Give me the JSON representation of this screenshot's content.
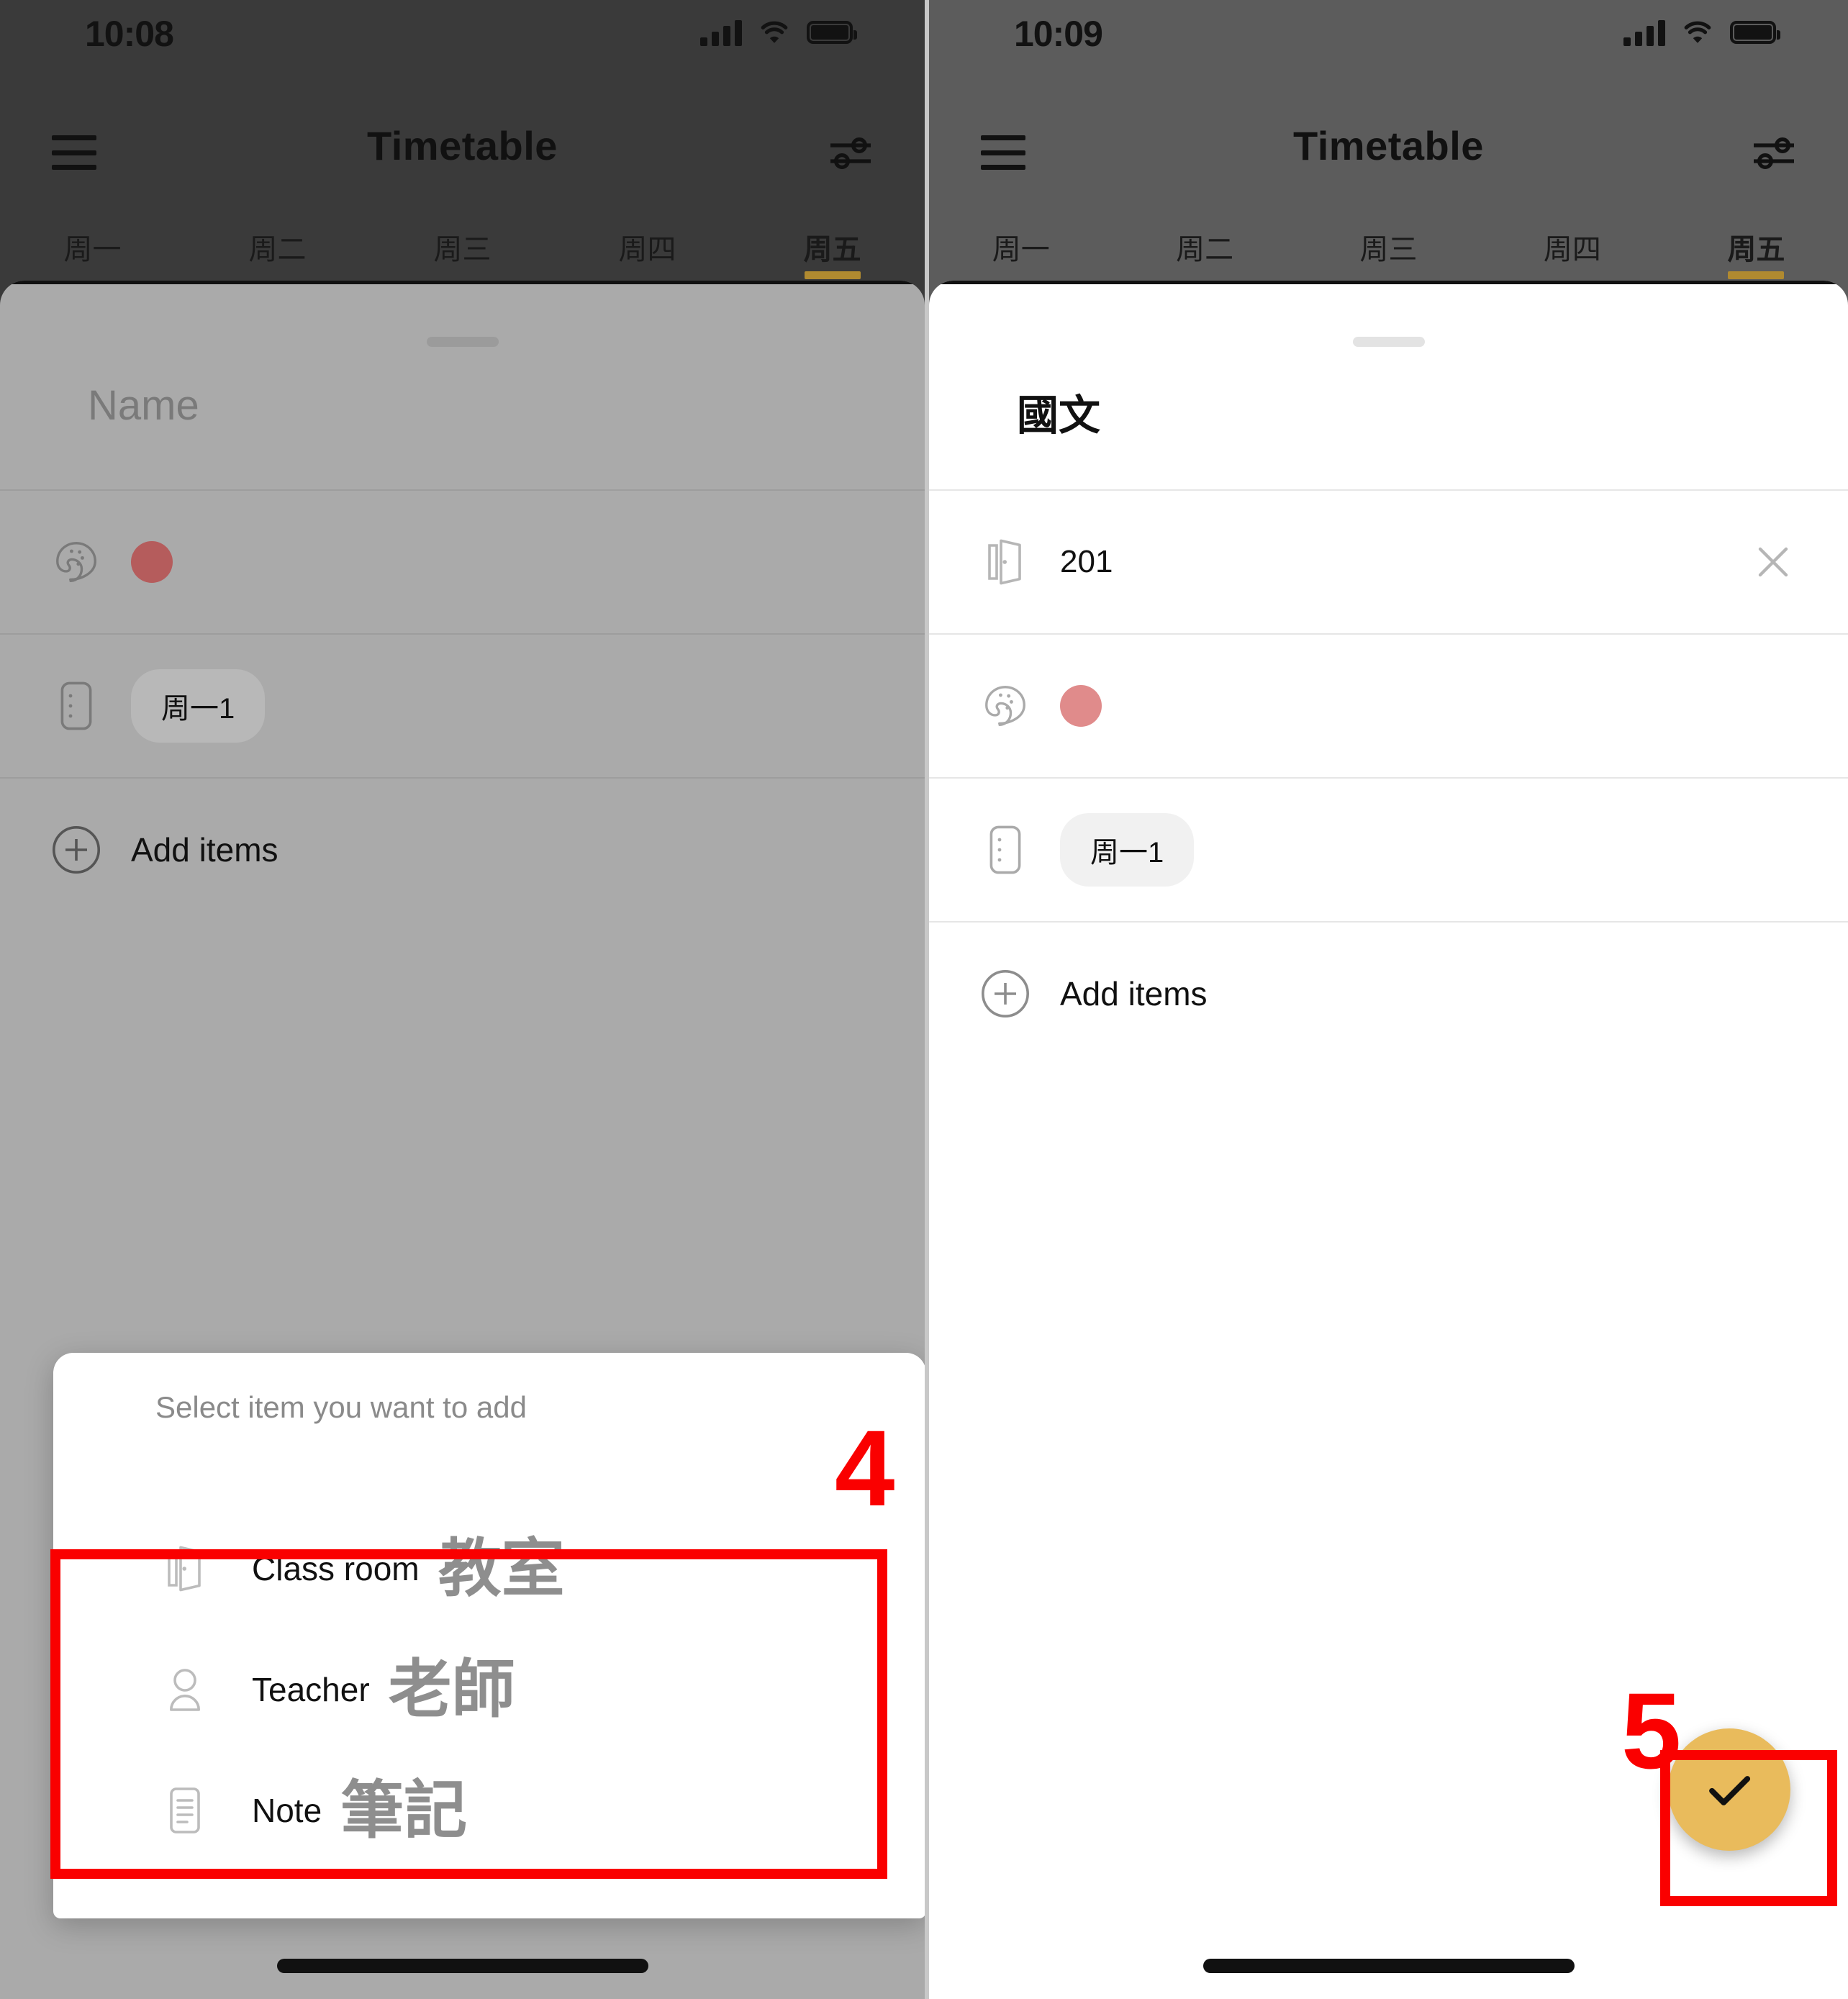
{
  "left_panel": {
    "status": {
      "time": "10:08",
      "signal_icon": "cellular-bars-icon",
      "wifi_icon": "wifi-icon",
      "battery_icon": "battery-full-icon"
    },
    "appbar": {
      "menu_icon": "hamburger-menu-icon",
      "title": "Timetable",
      "filter_icon": "settings-sliders-icon"
    },
    "tabs": [
      {
        "label": "周一",
        "active": false
      },
      {
        "label": "周二",
        "active": false
      },
      {
        "label": "周三",
        "active": false
      },
      {
        "label": "周四",
        "active": false
      },
      {
        "label": "周五",
        "active": true
      }
    ],
    "sheet": {
      "grabber": "drag-handle",
      "title": "Name",
      "rows": [
        {
          "icon": "palette-icon",
          "type": "color",
          "color": "#b55c5c"
        },
        {
          "icon": "period-icon",
          "type": "chip",
          "value": "周一1"
        }
      ],
      "add_icon": "plus-circle-icon",
      "add_label": "Add items"
    },
    "popup": {
      "header": "Select item you want to add",
      "items": [
        {
          "icon": "door-open-icon",
          "label": "Class room",
          "label_cn": "教室"
        },
        {
          "icon": "person-icon",
          "label": "Teacher",
          "label_cn": "老師"
        },
        {
          "icon": "note-lines-icon",
          "label": "Note",
          "label_cn": "筆記"
        }
      ]
    }
  },
  "right_panel": {
    "status": {
      "time": "10:09",
      "signal_icon": "cellular-bars-icon",
      "wifi_icon": "wifi-icon",
      "battery_icon": "battery-full-icon"
    },
    "appbar": {
      "menu_icon": "hamburger-menu-icon",
      "title": "Timetable",
      "filter_icon": "settings-sliders-icon"
    },
    "tabs": [
      {
        "label": "周一",
        "active": false
      },
      {
        "label": "周二",
        "active": false
      },
      {
        "label": "周三",
        "active": false
      },
      {
        "label": "周四",
        "active": false
      },
      {
        "label": "周五",
        "active": true
      }
    ],
    "sheet": {
      "grabber": "drag-handle",
      "title": "國文",
      "rows": [
        {
          "icon": "door-open-icon",
          "type": "text",
          "value": "201",
          "close_icon": "close-x-icon"
        },
        {
          "icon": "palette-icon",
          "type": "color",
          "color": "#e08b8b"
        },
        {
          "icon": "period-icon",
          "type": "chip",
          "value": "周一1"
        }
      ],
      "add_icon": "plus-circle-icon",
      "add_label": "Add items"
    },
    "fab": {
      "icon": "check-icon",
      "color": "#e9bb5c"
    }
  },
  "annotations": {
    "accent_color": "#fa0000",
    "step4": "4",
    "step5": "5"
  }
}
